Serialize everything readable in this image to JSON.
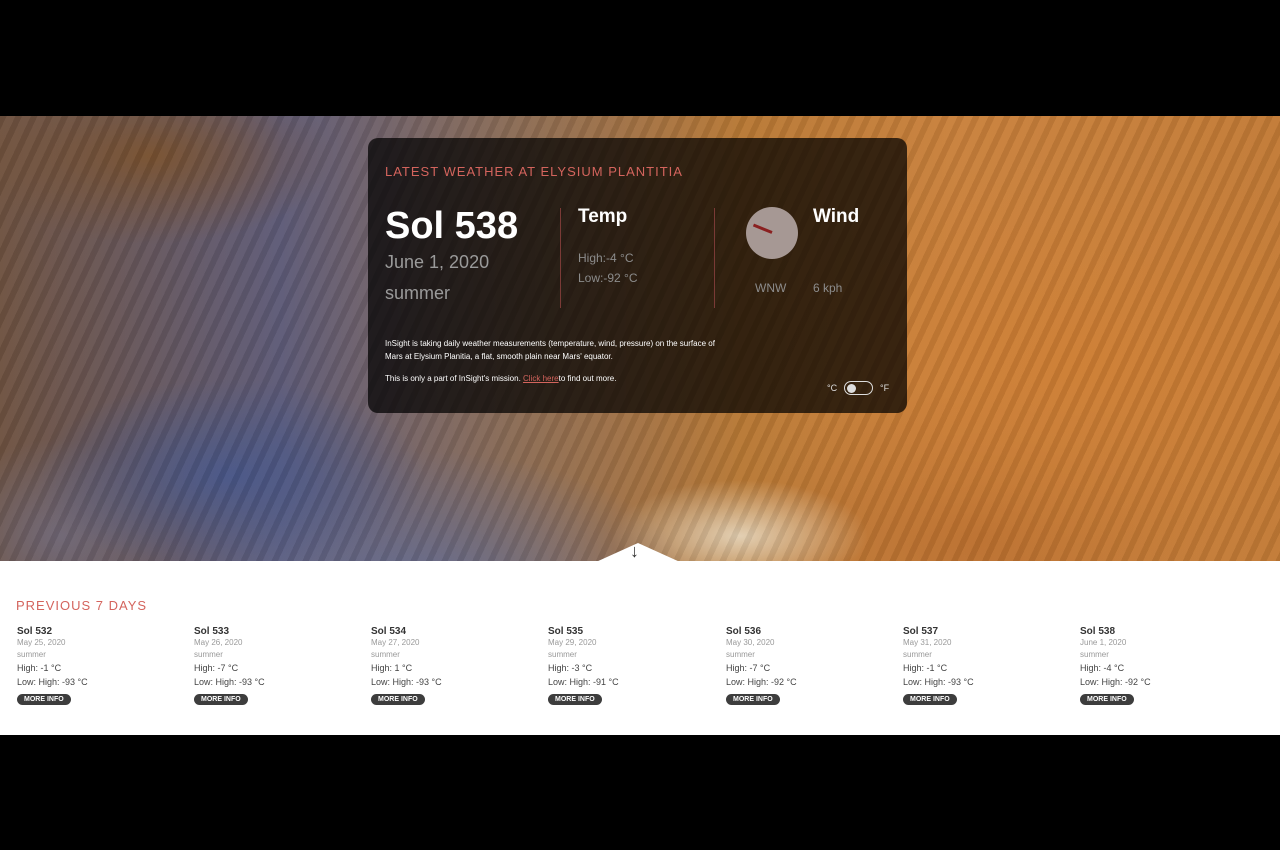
{
  "current": {
    "heading": "LATEST WEATHER AT ELYSIUM PLANTITIA",
    "sol": "Sol 538",
    "date": "June 1, 2020",
    "season": "summer",
    "temp_title": "Temp",
    "temp_high": "High:-4 °C",
    "temp_low": "Low:-92 °C",
    "wind_title": "Wind",
    "wind_direction": "WNW",
    "wind_speed": "6 kph",
    "info_text": "InSight is taking daily weather measurements (temperature, wind, pressure) on the surface of Mars at Elysium Planitia, a flat, smooth plain near Mars' equator.",
    "mission_text_before": "This is only a part of InSight's mission. ",
    "mission_link": "Click here",
    "mission_text_after": "to find out more.",
    "unit_c": "°C",
    "unit_f": "°F"
  },
  "previous": {
    "heading": "PREVIOUS 7 DAYS",
    "button_label": "MORE INFO",
    "days": [
      {
        "sol": "Sol 532",
        "date": "May 25, 2020",
        "season": "summer",
        "high": "High: -1 °C",
        "low": "Low: High: -93 °C"
      },
      {
        "sol": "Sol 533",
        "date": "May 26, 2020",
        "season": "summer",
        "high": "High: -7 °C",
        "low": "Low: High: -93 °C"
      },
      {
        "sol": "Sol 534",
        "date": "May 27, 2020",
        "season": "summer",
        "high": "High: 1 °C",
        "low": "Low: High: -93 °C"
      },
      {
        "sol": "Sol 535",
        "date": "May 29, 2020",
        "season": "summer",
        "high": "High: -3 °C",
        "low": "Low: High: -91 °C"
      },
      {
        "sol": "Sol 536",
        "date": "May 30, 2020",
        "season": "summer",
        "high": "High: -7 °C",
        "low": "Low: High: -92 °C"
      },
      {
        "sol": "Sol 537",
        "date": "May 31, 2020",
        "season": "summer",
        "high": "High: -1 °C",
        "low": "Low: High: -93 °C"
      },
      {
        "sol": "Sol 538",
        "date": "June 1, 2020",
        "season": "summer",
        "high": "High: -4 °C",
        "low": "Low: High: -92 °C"
      }
    ]
  },
  "colors": {
    "accent": "#d4645d",
    "panel_bg": "#000000",
    "button_bg": "#3d3d3d"
  }
}
